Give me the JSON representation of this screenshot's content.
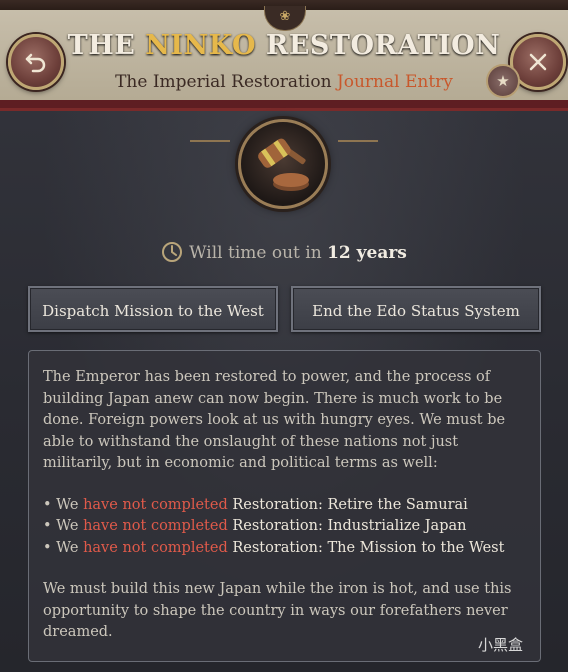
{
  "header": {
    "title_part1": "THE ",
    "title_highlight": "NINKO",
    "title_part2": " RESTORATION",
    "subtitle_prefix": "The Imperial Restoration ",
    "subtitle_accent": "Journal Entry"
  },
  "icons": {
    "back": "undo-arrow-icon",
    "close": "close-icon",
    "favorite": "star-icon",
    "emblem": "gavel-icon",
    "timer": "clock-icon"
  },
  "timer": {
    "prefix": "Will time out in ",
    "value": "12 years"
  },
  "actions": [
    {
      "label": "Dispatch Mission to the West"
    },
    {
      "label": "End the Edo Status System"
    }
  ],
  "description": {
    "intro": "The Emperor has been restored to power, and the process of building Japan anew can now begin. There is much work to be done. Foreign powers look at us with hungry eyes. We must be able to withstand the onslaught of these nations not just militarily, but in economic and political terms as well:",
    "conditions": [
      {
        "prefix": "• We ",
        "status": "have not completed",
        "target": " Restoration: Retire the Samurai"
      },
      {
        "prefix": "• We ",
        "status": "have not completed",
        "target": " Restoration: Industrialize Japan"
      },
      {
        "prefix": "• We ",
        "status": "have not completed",
        "target": " Restoration: The Mission to the West"
      }
    ],
    "outro": "We must build this new Japan while the iron is hot, and use this opportunity to shape the country in ways our forefathers never dreamed."
  },
  "watermark": "小黑盒",
  "colors": {
    "title_highlight": "#e6b84b",
    "journal_accent": "#c8582c",
    "not_completed": "#e05a4a",
    "header_band": "#7a2a2a"
  }
}
